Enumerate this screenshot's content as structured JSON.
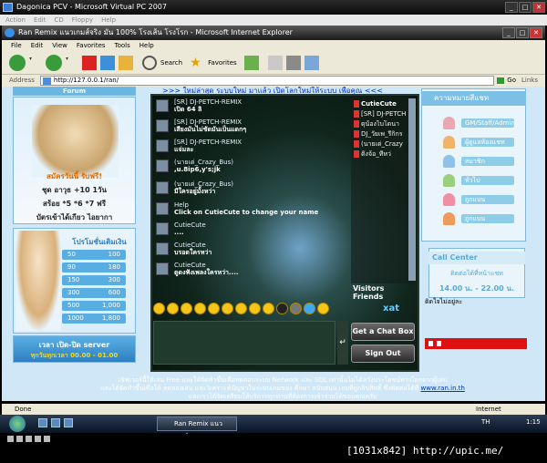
{
  "vpc": {
    "title": "Dagonica PCV - Microsoft Virtual PC 2007",
    "menu": [
      "Action",
      "Edit",
      "CD",
      "Floppy",
      "Help"
    ]
  },
  "ie": {
    "title": "Ran Remix แนวเกมส์จริง มัน 100% โรงเส้น โรงโรก - Microsoft Internet Explorer",
    "menu": [
      "File",
      "Edit",
      "View",
      "Favorites",
      "Tools",
      "Help"
    ],
    "toolbar": {
      "search": "Search",
      "favorites": "Favorites"
    },
    "address_label": "Address",
    "address": "http://127.0.0.1/ran/",
    "go": "Go",
    "links": "Links",
    "status": "Done",
    "zone": "Internet"
  },
  "page": {
    "marquee": ">>> ใหม่ล่าสุด ระบบใหม่ มาแล้ว เปิดโลกใหม่ให้ระบบ เพื่อคุณ <<<",
    "left_header": "Forum",
    "promo": {
      "line1": "สมัครวันนี้  รับฟรี!",
      "line2": "ชุด อาวุธ +10 1วัน",
      "line3": "สร้อย *5 *6 *7 ฟรี",
      "line4": "บัตรเข้าได้เกียว ไอยากา"
    },
    "topup": {
      "title": "โปรโมชั่นเติมเงิน",
      "rows": [
        [
          "50",
          "100"
        ],
        [
          "90",
          "180"
        ],
        [
          "150",
          "300"
        ],
        [
          "300",
          "600"
        ],
        [
          "500",
          "1,000"
        ],
        [
          "1000",
          "1,800"
        ]
      ]
    },
    "server": {
      "title": "เวลา เปิด-ปิด server",
      "time": "ทุกวันทุกเวลา 00.00 - 01.00"
    },
    "footer_line1": "เซิฟเวอร์นี้ให้เล่น Free และให้จัดทำขึ้นเพื่อทดสอบระบบ Network และ SQL เท่านั้นไม่ได้หวังประโยชน์ทางใดๆจากผู้เล่น",
    "footer_line2": "และได้จัดทำขึ้นเพื่อให้ ทดลองเล่น และวิเคราะห์ปัญหาในระบบเกมของ ศึกษา สนับสนุน เกมที่ถูกลิขสิทธิ์ ซึ่งติดต่อได้ที่",
    "footer_line3": "และเราได้จัดเตรียมให้บริการทุกท่านที่ต้องการเข้าร่วมได้ขอบคุณครับ",
    "footer_link": "www.ran.in.th"
  },
  "chat": {
    "messages": [
      {
        "name": "[SR] DJ-PETCH-REMIX",
        "text": "เปิด 64 ลิ"
      },
      {
        "name": "[SR] DJ-PETCH-REMIX",
        "text": "เสียงมันไม่ชัดมันเป็นแดกๆ"
      },
      {
        "name": "[SR] DJ-PETCH-REMIX",
        "text": "แจ่มละ"
      },
      {
        "name": "(นายเด่_Crazy_Bus)",
        "text": ",u.8ip6,y's;jk"
      },
      {
        "name": "(นายเด่_Crazy_Bus)",
        "text": "มีใครอยู่มั้งหว่า"
      },
      {
        "name": "Help",
        "text": "Click on  CutieCute to change your name"
      },
      {
        "name": "CutieCute",
        "text": "...."
      },
      {
        "name": "CutieCute",
        "text": "บรอดใครหว่า"
      },
      {
        "name": "CutieCute",
        "text": "ดูดงฟังเพลงใครหว่า...."
      }
    ],
    "users": [
      "CutieCute",
      "[SR] DJ-PETCH",
      "ดุน้องไบโดนา",
      "DJ_วัยเพ_รีกิกร",
      "(นายเด่_Crazy",
      "ติ๊งจ้อ_ที่หว่"
    ],
    "visitors_label": "Visitors Friends",
    "xat": "xat",
    "buttons": {
      "get_box": "Get a Chat Box",
      "sign_out": "Sign Out"
    }
  },
  "right": {
    "header": "ความหมายสีแชท",
    "items": [
      "GM/Staff/Admin",
      "ผู้ดูแลห้องแชท",
      "สมาชิก",
      "ทั่วไป",
      "ถูกแบน",
      "ถูกแบน"
    ],
    "call_title": "Call Center",
    "call_sub": "ติดต่อได้ที่หน้าแชท",
    "call_time": "14.00 น. - 22.00 น.",
    "song": "ติดใจไม่อยู่ละ"
  },
  "taskbar": {
    "task": "Ran Remix แนวเกมส์...",
    "lang": "TH",
    "time": "1:15"
  },
  "caption": "[1031x842] http://upic.me/"
}
